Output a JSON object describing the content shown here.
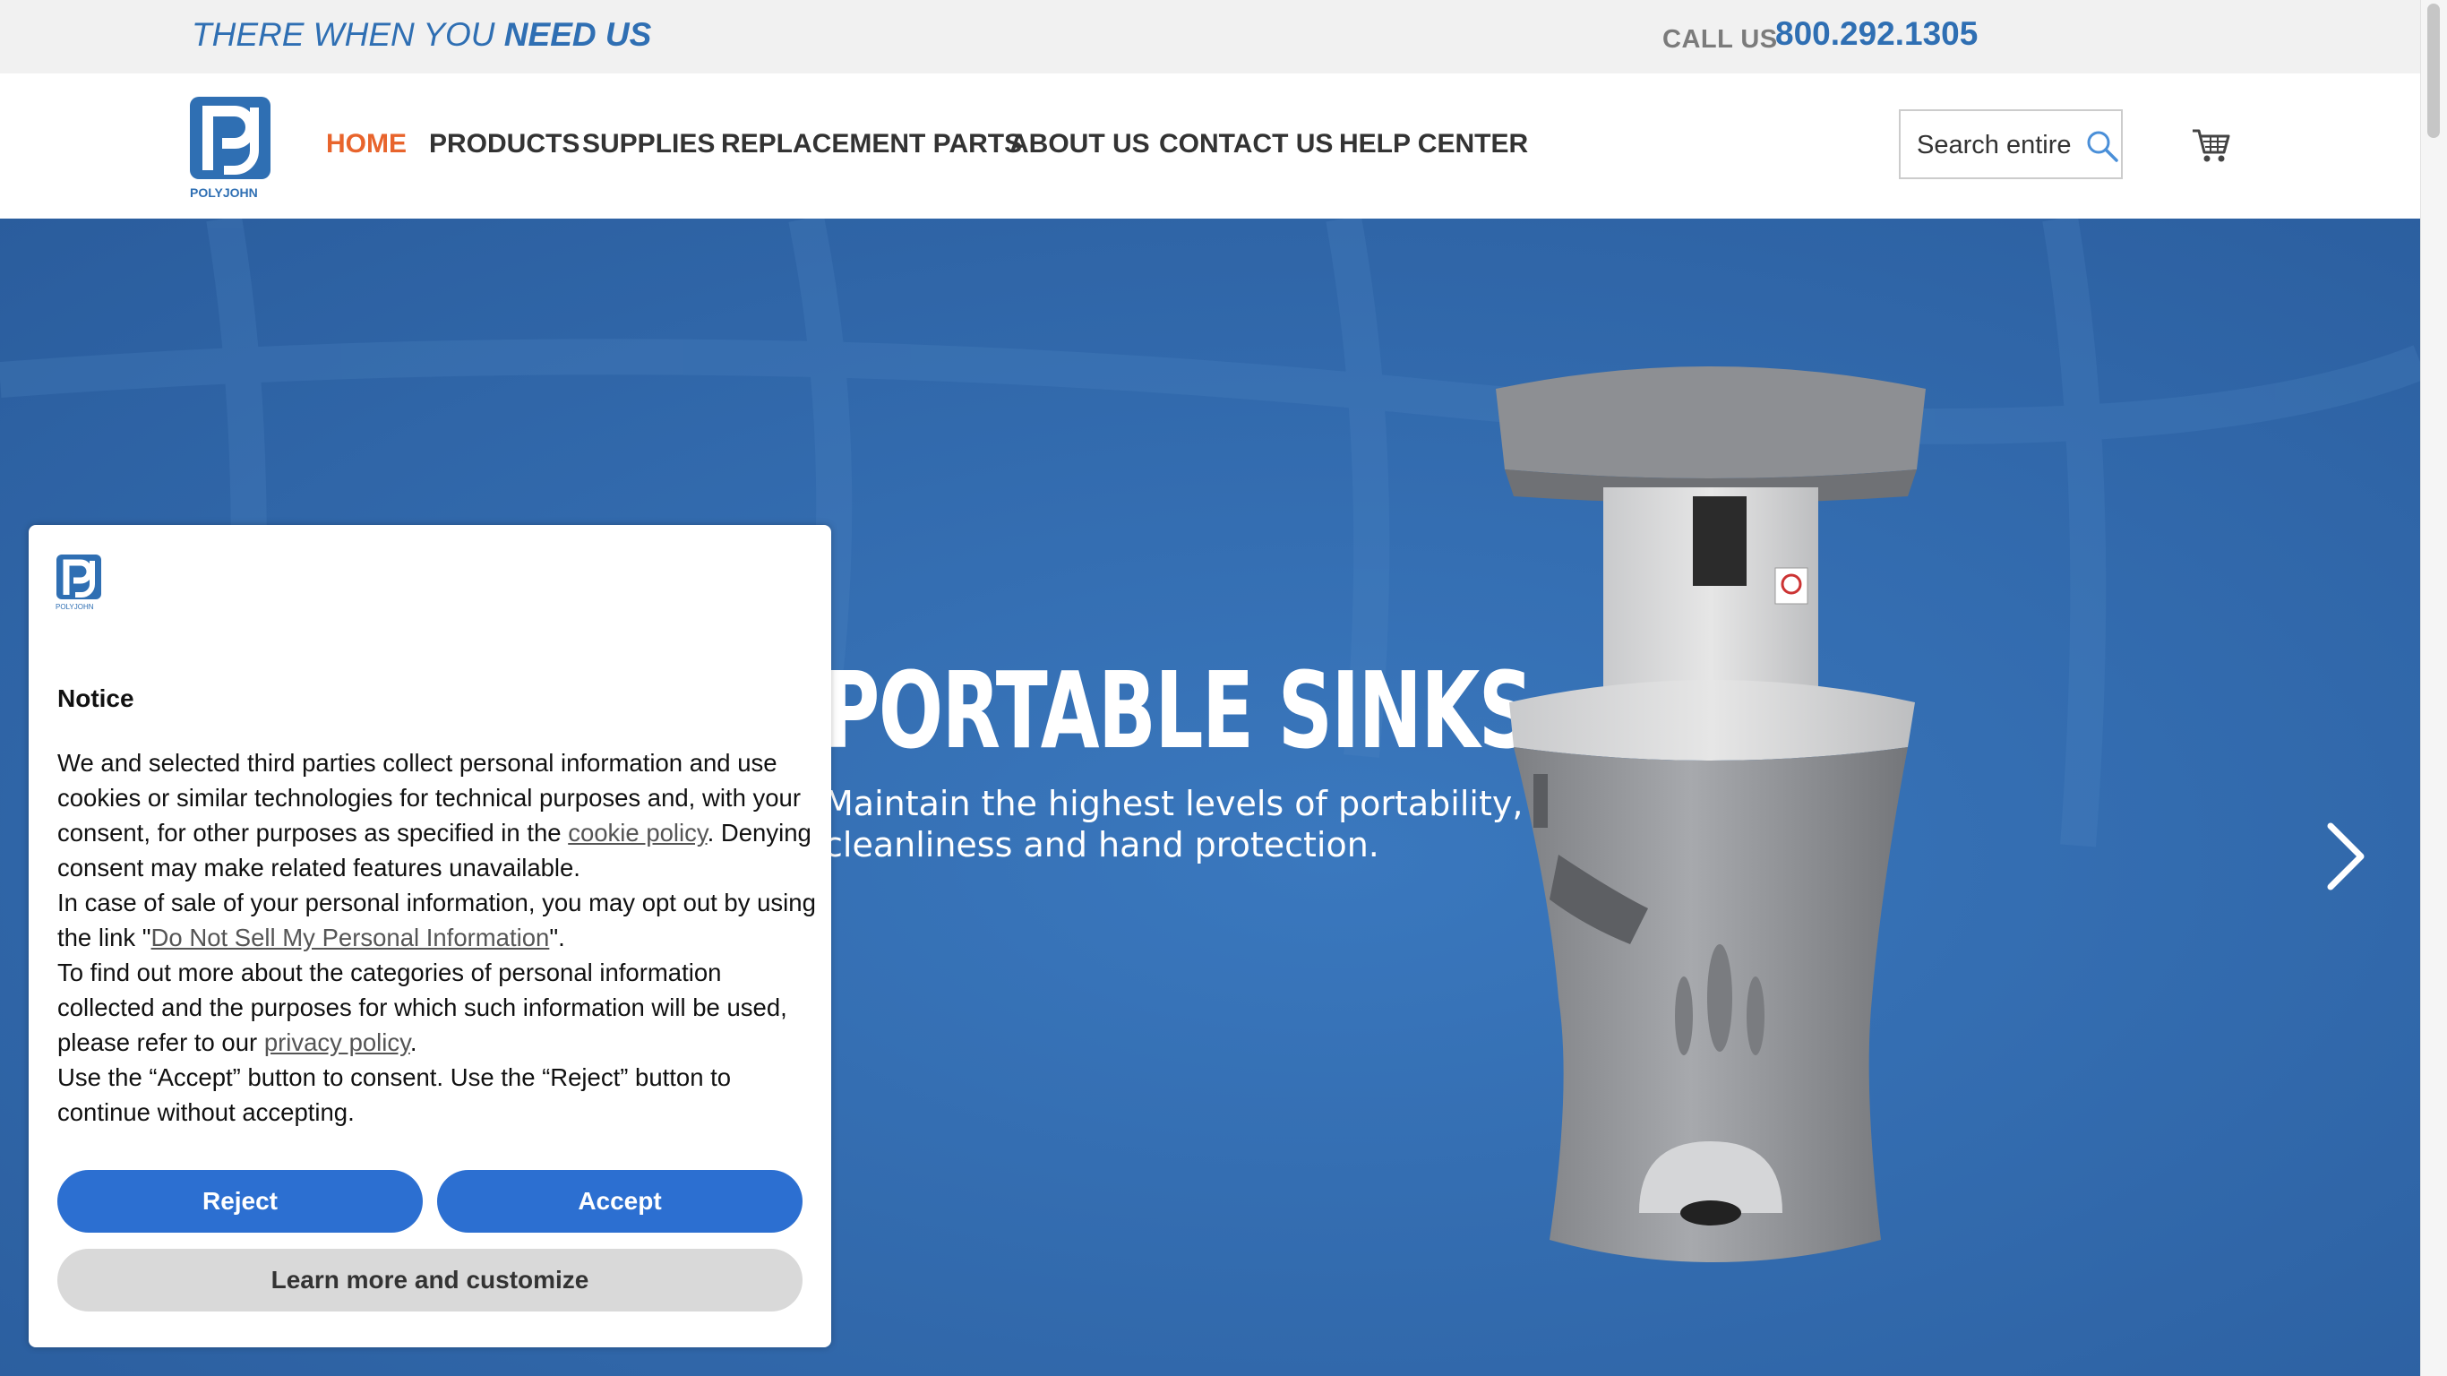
{
  "topbar": {
    "tagline_part1": "THERE WHEN YOU ",
    "tagline_part2": "NEED US",
    "call_label": "CALL US",
    "phone": "800.292.1305"
  },
  "brand": {
    "logo_text": "POLYJOHN"
  },
  "nav": {
    "items": [
      {
        "label": "HOME"
      },
      {
        "label": "PRODUCTS"
      },
      {
        "label": "SUPPLIES"
      },
      {
        "label": "REPLACEMENT PARTS"
      },
      {
        "label": "ABOUT US"
      },
      {
        "label": "CONTACT US"
      },
      {
        "label": "HELP CENTER"
      }
    ]
  },
  "search": {
    "placeholder": "Search entire store here..."
  },
  "hero": {
    "title": "PORTABLE SINKS",
    "subtitle_line1": "Maintain the highest levels of portability,",
    "subtitle_line2": "cleanliness and hand protection."
  },
  "cookie": {
    "logo_text": "POLYJOHN",
    "title": "Notice",
    "p1_text": "We and selected third parties collect personal information and use cookies or similar technologies for technical purposes and, with your consent, for other purposes as specified in the ",
    "p1_link": "cookie policy",
    "p1_end": ". Denying consent may make related features unavailable.",
    "p2_text": "In case of sale of your personal information, you may opt out by using the link \"",
    "p2_link": "Do Not Sell My Personal Information",
    "p2_end": "\".",
    "p3_text": "To find out more about the categories of personal information collected and the purposes for which such information will be used, please refer to our ",
    "p3_link": "privacy policy",
    "p3_end": ".",
    "p4_text": "Use the “Accept” button to consent. Use the “Reject” button to continue without accepting.",
    "reject_label": "Reject",
    "accept_label": "Accept",
    "learn_label": "Learn more and customize"
  },
  "colors": {
    "brand_blue": "#2f6fb3",
    "active_nav": "#e8642c",
    "hero_bg": "#2f67a9",
    "button_blue": "#2c6fd1"
  },
  "icons": [
    "search-icon",
    "cart-icon",
    "chevron-right-icon",
    "polyjohn-logo"
  ]
}
